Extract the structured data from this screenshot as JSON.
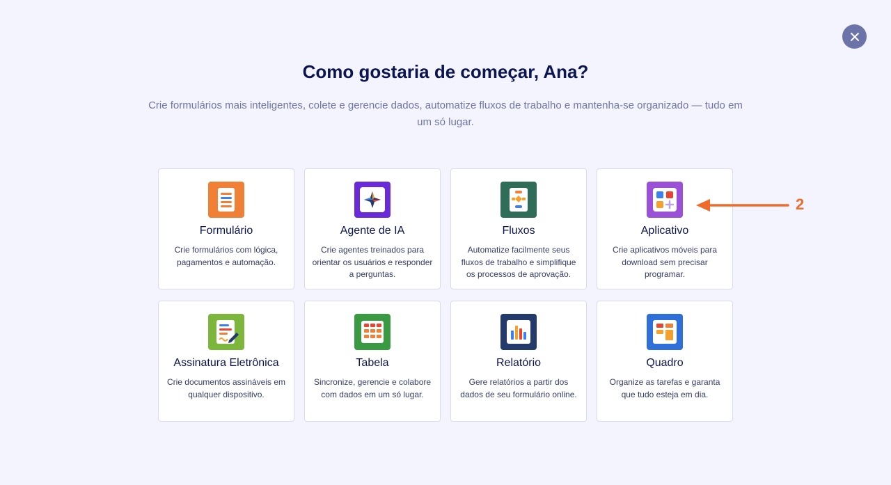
{
  "dialog": {
    "title": "Como gostaria de começar, Ana?",
    "subtitle": "Crie formulários mais inteligentes, colete e gerencie dados, automatize fluxos de trabalho e mantenha-se organizado — tudo em um só lugar.",
    "close_icon": "close-icon"
  },
  "cards": [
    {
      "title": "Formulário",
      "description": "Crie formulários com lógica, pagamentos e automação.",
      "icon": "form-icon",
      "color": "#f08035"
    },
    {
      "title": "Agente de IA",
      "description": "Crie agentes treinados para orientar os usuários e responder a perguntas.",
      "icon": "ai-agent-icon",
      "color": "#6b2ad9"
    },
    {
      "title": "Fluxos",
      "description": "Automatize facilmente seus fluxos de trabalho e simplifique os processos de aprovação.",
      "icon": "workflow-icon",
      "color": "#2f6d58"
    },
    {
      "title": "Aplicativo",
      "description": "Crie aplicativos móveis para download sem precisar programar.",
      "icon": "app-icon",
      "color": "#9b50d8"
    },
    {
      "title": "Assinatura Eletrônica",
      "description": "Crie documentos assináveis em qualquer dispositivo.",
      "icon": "e-signature-icon",
      "color": "#7db63c"
    },
    {
      "title": "Tabela",
      "description": "Sincronize, gerencie e colabore com dados em um só lugar.",
      "icon": "table-icon",
      "color": "#3a9a42"
    },
    {
      "title": "Relatório",
      "description": "Gere relatórios a partir dos dados de seu formulário online.",
      "icon": "report-icon",
      "color": "#243a6a"
    },
    {
      "title": "Quadro",
      "description": "Organize as tarefas e garanta que tudo esteja em dia.",
      "icon": "board-icon",
      "color": "#2f6fd8"
    }
  ],
  "annotation": {
    "label": "2",
    "color": "#ef6b2c"
  }
}
